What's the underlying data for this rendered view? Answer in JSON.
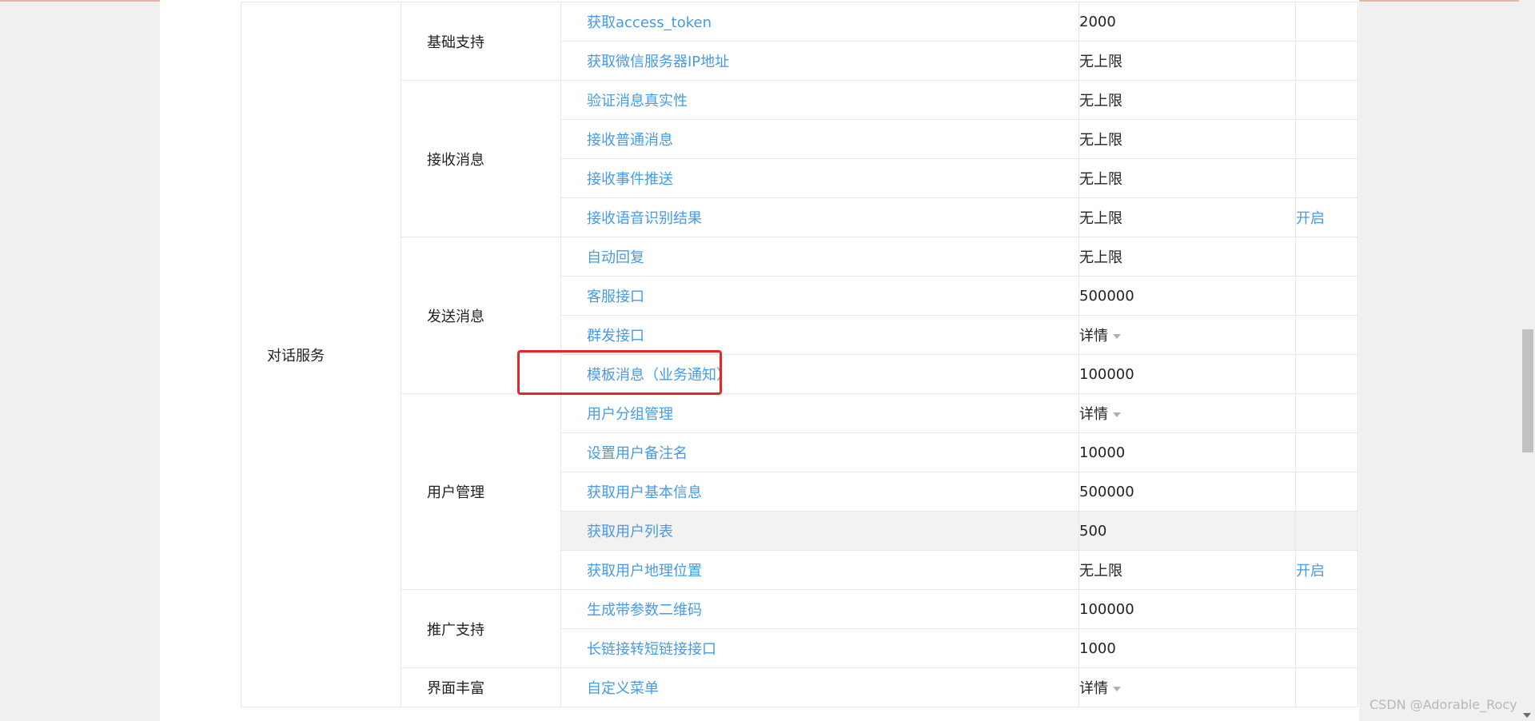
{
  "table": {
    "service": "对话服务",
    "groups": [
      {
        "category": "基础支持",
        "rows": [
          {
            "name": "获取access_token",
            "quota": "2000",
            "extra": ""
          },
          {
            "name": "获取微信服务器IP地址",
            "quota": "无上限",
            "extra": ""
          }
        ]
      },
      {
        "category": "接收消息",
        "rows": [
          {
            "name": "验证消息真实性",
            "quota": "无上限",
            "extra": ""
          },
          {
            "name": "接收普通消息",
            "quota": "无上限",
            "extra": ""
          },
          {
            "name": "接收事件推送",
            "quota": "无上限",
            "extra": ""
          },
          {
            "name": "接收语音识别结果",
            "quota": "无上限",
            "extra": "开启"
          }
        ]
      },
      {
        "category": "发送消息",
        "rows": [
          {
            "name": "自动回复",
            "quota": "无上限",
            "extra": ""
          },
          {
            "name": "客服接口",
            "quota": "500000",
            "extra": ""
          },
          {
            "name": "群发接口",
            "quota": "详情",
            "extra": ""
          },
          {
            "name": "模板消息（业务通知）",
            "quota": "100000",
            "extra": ""
          }
        ]
      },
      {
        "category": "用户管理",
        "rows": [
          {
            "name": "用户分组管理",
            "quota": "详情",
            "extra": ""
          },
          {
            "name": "设置用户备注名",
            "quota": "10000",
            "extra": ""
          },
          {
            "name": "获取用户基本信息",
            "quota": "500000",
            "extra": ""
          },
          {
            "name": "获取用户列表",
            "quota": "500",
            "extra": ""
          },
          {
            "name": "获取用户地理位置",
            "quota": "无上限",
            "extra": "开启"
          }
        ]
      },
      {
        "category": "推广支持",
        "rows": [
          {
            "name": "生成带参数二维码",
            "quota": "100000",
            "extra": ""
          },
          {
            "name": "长链接转短链接接口",
            "quota": "1000",
            "extra": ""
          }
        ]
      },
      {
        "category": "界面丰富",
        "rows": [
          {
            "name": "自定义菜单",
            "quota": "详情",
            "extra": ""
          }
        ]
      }
    ]
  },
  "watermark": "CSDN @Adorable_Rocy",
  "colors": {
    "link": "#459ae9",
    "highlight_border": "#e8262a",
    "row_hover": "#f2f2f2"
  }
}
